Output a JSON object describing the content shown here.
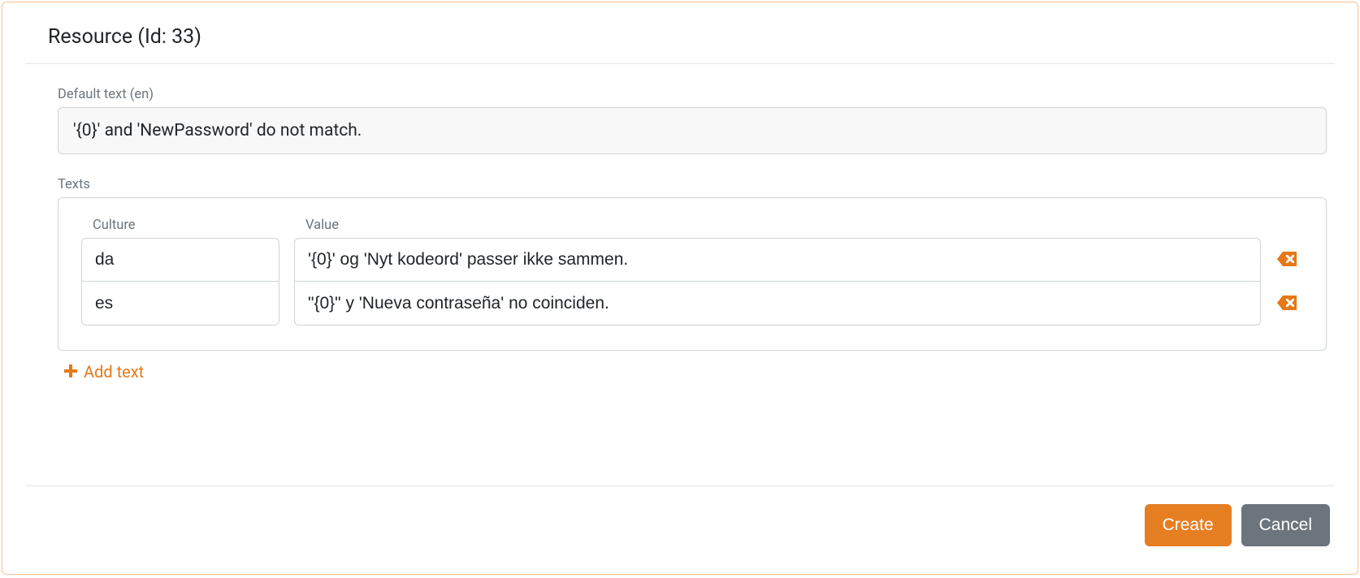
{
  "title": "Resource (Id: 33)",
  "defaultLabel": "Default text (en)",
  "defaultValue": "'{0}' and 'NewPassword' do not match.",
  "textsLabel": "Texts",
  "columns": {
    "culture": "Culture",
    "value": "Value"
  },
  "rows": [
    {
      "culture": "da",
      "value": "'{0}' og 'Nyt kodeord' passer ikke sammen."
    },
    {
      "culture": "es",
      "value": "\"{0}\" y 'Nueva contraseña' no coinciden."
    }
  ],
  "addText": "Add text",
  "buttons": {
    "create": "Create",
    "cancel": "Cancel"
  }
}
